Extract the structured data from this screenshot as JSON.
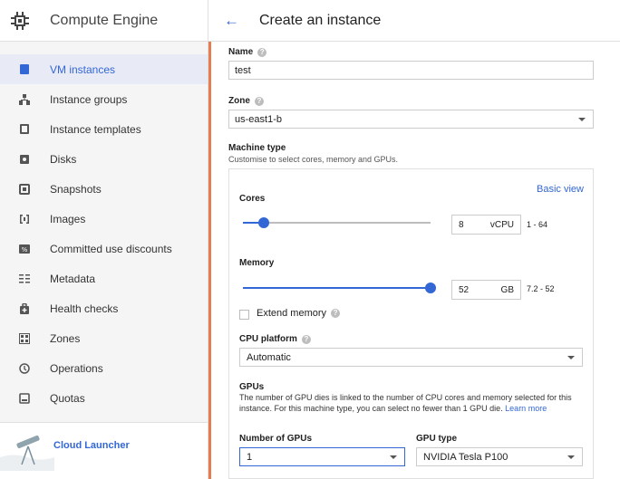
{
  "sidebar": {
    "title": "Compute Engine",
    "items": [
      {
        "label": "VM instances",
        "icon": "vm-instances-icon",
        "active": true
      },
      {
        "label": "Instance groups",
        "icon": "instance-groups-icon"
      },
      {
        "label": "Instance templates",
        "icon": "instance-templates-icon"
      },
      {
        "label": "Disks",
        "icon": "disks-icon"
      },
      {
        "label": "Snapshots",
        "icon": "snapshots-icon"
      },
      {
        "label": "Images",
        "icon": "images-icon"
      },
      {
        "label": "Committed use discounts",
        "icon": "discount-icon"
      },
      {
        "label": "Metadata",
        "icon": "metadata-icon"
      },
      {
        "label": "Health checks",
        "icon": "health-checks-icon"
      },
      {
        "label": "Zones",
        "icon": "zones-icon"
      },
      {
        "label": "Operations",
        "icon": "operations-icon"
      },
      {
        "label": "Quotas",
        "icon": "quotas-icon"
      }
    ],
    "launcher_label": "Cloud Launcher"
  },
  "header": {
    "title": "Create an instance"
  },
  "form": {
    "name_label": "Name",
    "name_value": "test",
    "zone_label": "Zone",
    "zone_value": "us-east1-b",
    "machine_type_label": "Machine type",
    "machine_type_hint": "Customise to select cores, memory and GPUs.",
    "basic_view": "Basic view",
    "cores": {
      "label": "Cores",
      "value": "8",
      "unit": "vCPU",
      "range": "1 - 64",
      "level": 0.11
    },
    "memory": {
      "label": "Memory",
      "value": "52",
      "unit": "GB",
      "range": "7.2 - 52",
      "level": 1.0
    },
    "extend_memory_label": "Extend memory",
    "cpu_platform_label": "CPU platform",
    "cpu_platform_value": "Automatic",
    "gpus_label": "GPUs",
    "gpus_desc": "The number of GPU dies is linked to the number of CPU cores and memory selected for this instance. For this machine type, you can select no fewer than 1 GPU die.",
    "learn_more": "Learn more",
    "num_gpus_label": "Number of GPUs",
    "num_gpus_value": "1",
    "gpu_type_label": "GPU type",
    "gpu_type_value": "NVIDIA Tesla P100"
  },
  "colors": {
    "accent": "#3367d6",
    "orange_bar": "#e67c52",
    "active_bg": "#e8eaf6"
  }
}
